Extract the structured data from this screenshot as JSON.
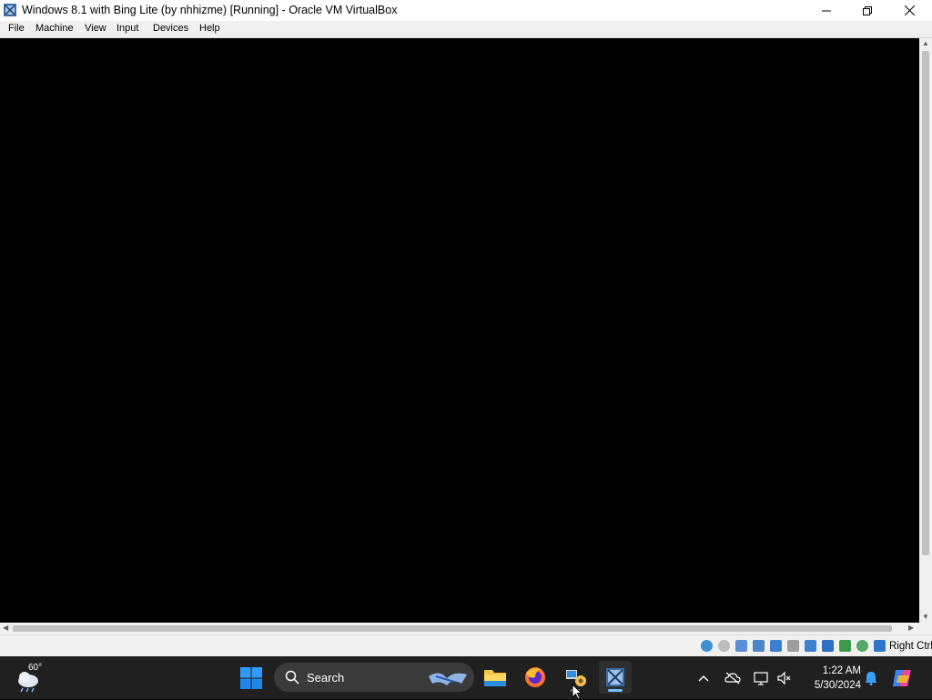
{
  "window": {
    "title": "Windows 8.1 with Bing Lite (by nhhizme) [Running] - Oracle VM VirtualBox",
    "icon": "virtualbox-icon"
  },
  "menubar": {
    "items": [
      {
        "label": "File"
      },
      {
        "label": "Machine"
      },
      {
        "label": "View"
      },
      {
        "label": "Input"
      },
      {
        "label": "Devices"
      },
      {
        "label": "Help"
      }
    ]
  },
  "statusbar": {
    "icons": [
      "hard-disk-icon",
      "optical-drive-icon",
      "audio-icon",
      "network-icon",
      "usb-icon",
      "shared-folders-icon",
      "display-icon",
      "recording-icon",
      "cpu-icon",
      "mouse-integration-icon",
      "host-key-icon"
    ],
    "host_key": "Right Ctrl"
  },
  "taskbar": {
    "weather_temp": "60°",
    "search_label": "Search",
    "apps": [
      "file-explorer-icon",
      "firefox-icon",
      "control-panel-icon",
      "virtualbox-icon"
    ],
    "time": "1:22 AM",
    "date": "5/30/2024"
  },
  "colors": {
    "taskbar_bg": "#202020",
    "accent": "#0078d4",
    "vm_screen": "#000000"
  }
}
